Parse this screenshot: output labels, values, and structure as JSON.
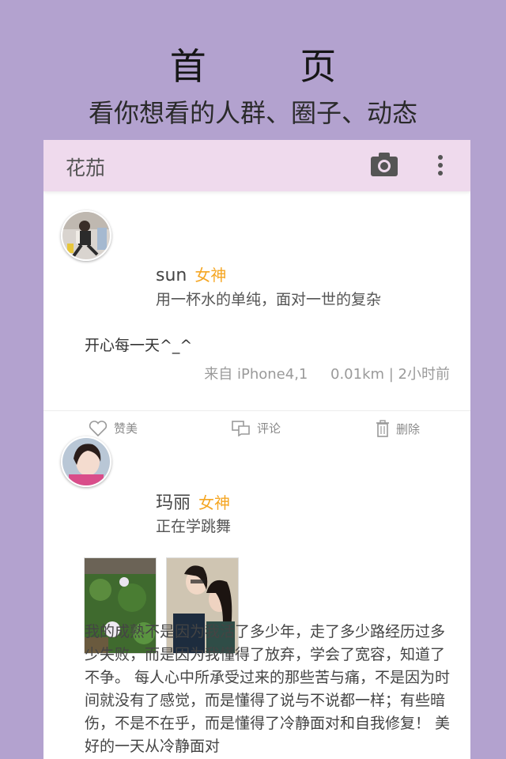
{
  "header": {
    "title": "首    页",
    "subtitle": "看你想看的人群、圈子、动态"
  },
  "appbar": {
    "title": "花茄",
    "camera_icon": "camera-icon",
    "more_icon": "more-vertical-icon"
  },
  "posts": [
    {
      "username": "sun",
      "badge": "女神",
      "signature": "用一杯水的单纯，面对一世的复杂",
      "content": "开心每一天^_^",
      "meta": "来自 iPhone4,1     0.01km | 2小时前",
      "actions": {
        "like": "赞美",
        "comment": "评论",
        "delete": "删除"
      }
    },
    {
      "username": "玛丽",
      "badge": "女神",
      "signature": "正在学跳舞",
      "content": "我的成熟不是因为我活了多少年，走了多少路经历过多少失败，而是因为我懂得了放弃，学会了宽容，知道了不争。 每人心中所承受过来的那些苦与痛，不是因为时间就没有了感觉，而是懂得了说与不说都一样；有些暗伤，不是不在乎，而是懂得了冷静面对和自我修复！ 美好的一天从冷静面对"
    }
  ],
  "colors": {
    "background": "#b3a2cf",
    "appbar": "#efdaed",
    "badge": "#f5a623"
  }
}
